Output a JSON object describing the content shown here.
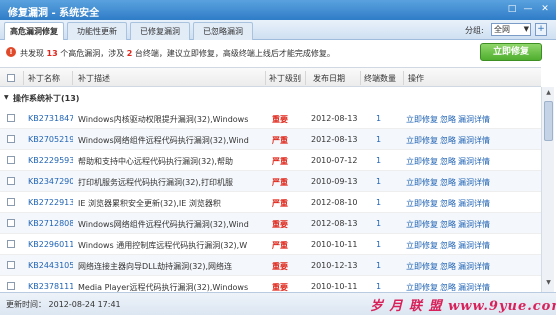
{
  "window": {
    "title": "修复漏洞 - 系统安全",
    "controls": [
      "□",
      "—",
      "✕"
    ]
  },
  "tabs": [
    {
      "label": "高危漏洞修复",
      "active": true
    },
    {
      "label": "功能性更新",
      "active": false
    },
    {
      "label": "已修复漏洞",
      "active": false
    },
    {
      "label": "已忽略漏洞",
      "active": false
    }
  ],
  "group": {
    "label": "分组:",
    "value": "全网"
  },
  "summary": {
    "part1": "共发现 ",
    "count_high": "13",
    "part2": " 个高危漏洞，涉及 ",
    "count_hosts": "2",
    "part3": " 台终端，建议立即修复，高级终端上线后才能完成修复。"
  },
  "fix_button": "立即修复",
  "columns": {
    "name": "补丁名称",
    "desc": "补丁描述",
    "level": "补丁级别",
    "date": "发布日期",
    "count": "终端数量",
    "action": "操作"
  },
  "group_row": "操作系统补丁(13)",
  "patches": [
    {
      "kb": "KB2731847",
      "desc": "Windows内核驱动权限提升漏洞(32),Windows",
      "level": "重要",
      "date": "2012-08-13",
      "count": "1"
    },
    {
      "kb": "KB2705219",
      "desc": "Windows网络组件远程代码执行漏洞(32),Wind",
      "level": "严重",
      "date": "2012-08-13",
      "count": "1"
    },
    {
      "kb": "KB2229593",
      "desc": "帮助和支持中心远程代码执行漏洞(32),帮助",
      "level": "严重",
      "date": "2010-07-12",
      "count": "1"
    },
    {
      "kb": "KB2347290",
      "desc": "打印机服务远程代码执行漏洞(32),打印机服",
      "level": "严重",
      "date": "2010-09-13",
      "count": "1"
    },
    {
      "kb": "KB2722913",
      "desc": "IE 浏览器累积安全更新(32),IE 浏览器积",
      "level": "严重",
      "date": "2012-08-10",
      "count": "1"
    },
    {
      "kb": "KB2712808",
      "desc": "Windows网络组件远程代码执行漏洞(32),Wind",
      "level": "重要",
      "date": "2012-08-13",
      "count": "1"
    },
    {
      "kb": "KB2296011",
      "desc": "Windows 通用控制库远程代码执行漏洞(32),W",
      "level": "严重",
      "date": "2010-10-11",
      "count": "1"
    },
    {
      "kb": "KB2443105",
      "desc": "网络连接主器向导DLL劫持漏洞(32),网络连",
      "level": "重要",
      "date": "2010-12-13",
      "count": "1"
    },
    {
      "kb": "KB2378111",
      "desc": "Media Player远程代码执行漏洞(32),Windows",
      "level": "重要",
      "date": "2010-10-11",
      "count": "1"
    }
  ],
  "actions": {
    "fix": "立即修复",
    "ignore": "忽略",
    "detail": "漏洞详情"
  },
  "footer": {
    "update_time": "更新时间： 2012-08-24 17:41"
  },
  "watermark": "岁 月 联 盟   www.9yue.com"
}
